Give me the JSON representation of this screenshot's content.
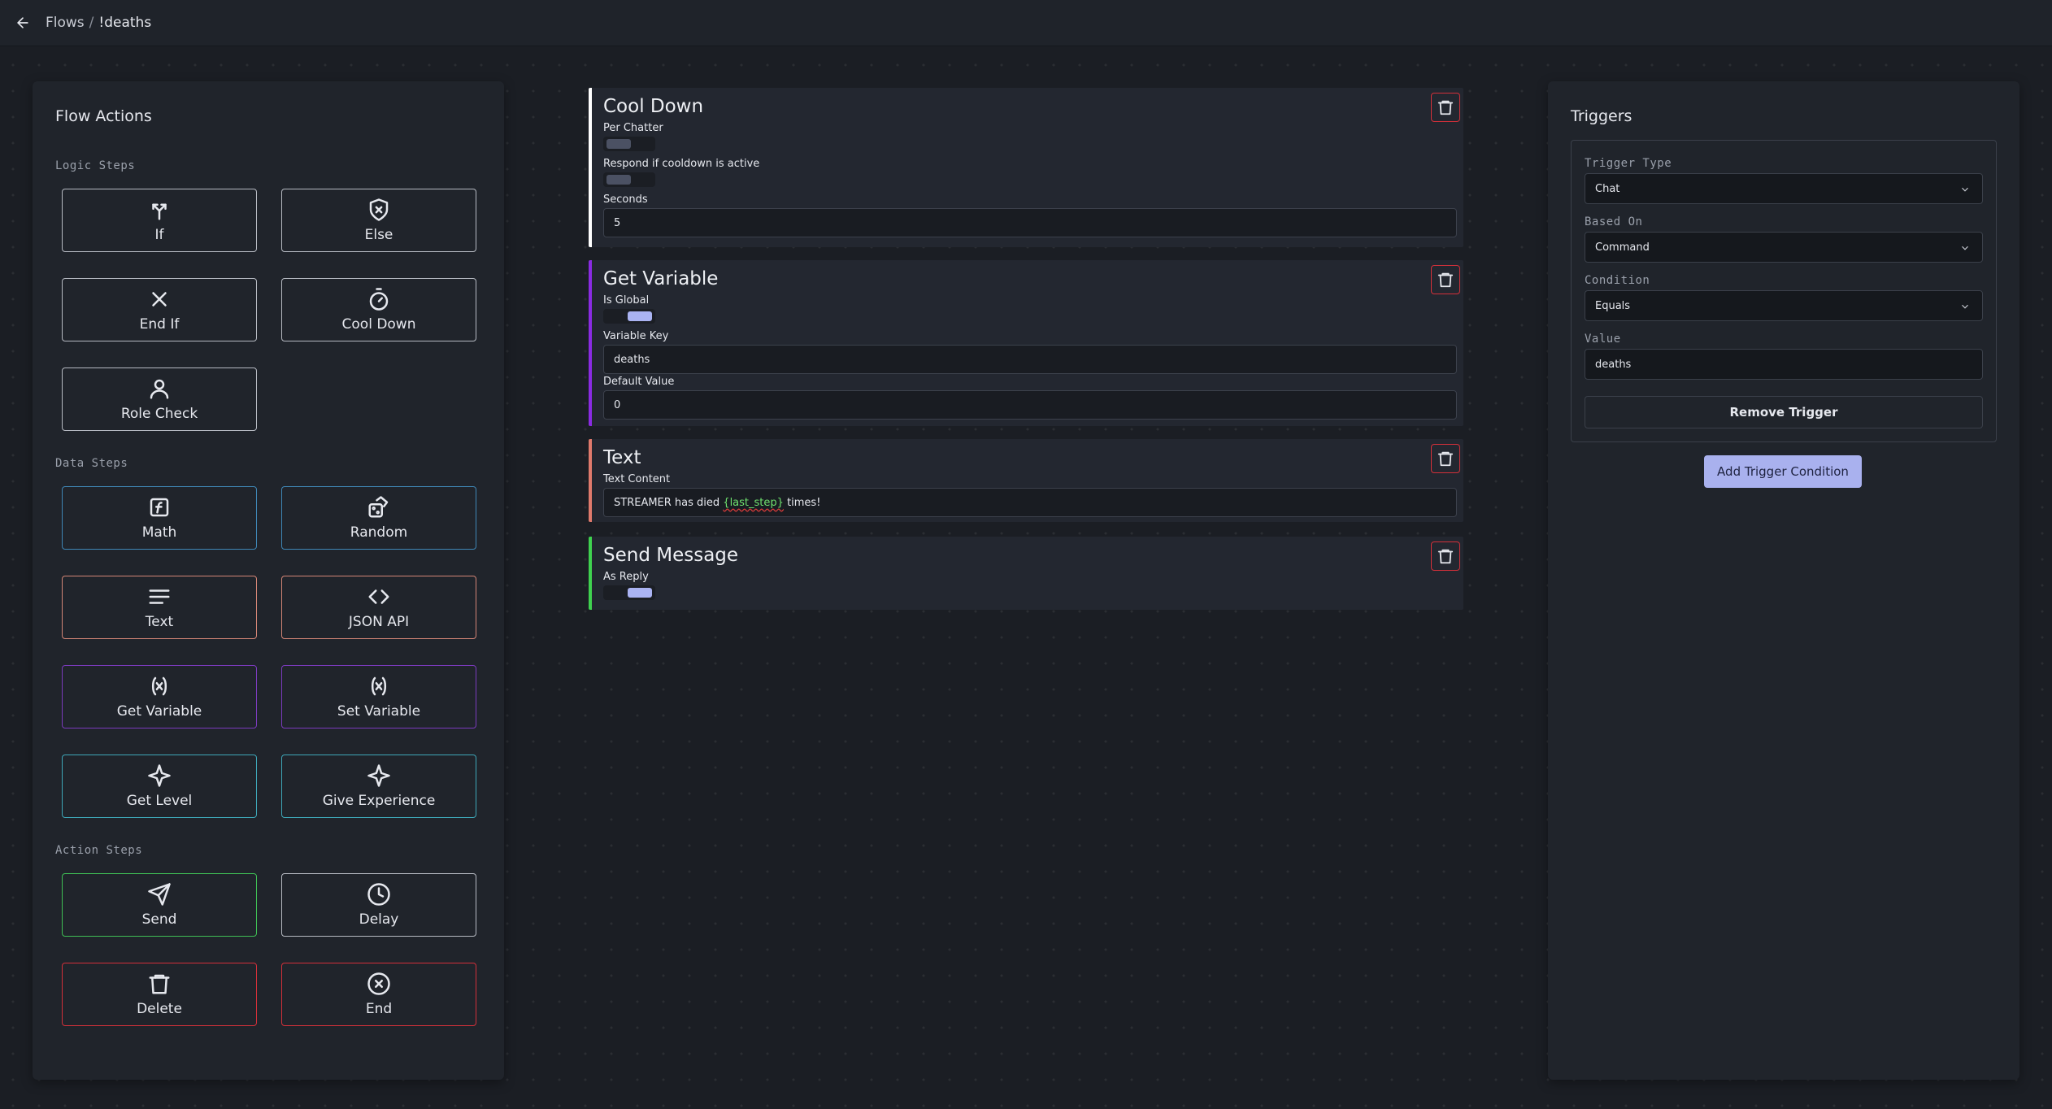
{
  "header": {
    "back_icon": "arrow-left-icon",
    "breadcrumb": {
      "parent": "Flows",
      "separator": "/",
      "current": "!deaths"
    }
  },
  "flow_actions": {
    "title": "Flow Actions",
    "logic_label": "Logic Steps",
    "logic": [
      {
        "label": "If",
        "icon": "branch-icon"
      },
      {
        "label": "Else",
        "icon": "shield-x-icon"
      },
      {
        "label": "End If",
        "icon": "x-icon"
      },
      {
        "label": "Cool Down",
        "icon": "timer-icon"
      },
      {
        "label": "Role Check",
        "icon": "user-icon"
      }
    ],
    "data_label": "Data Steps",
    "data": [
      {
        "label": "Math",
        "icon": "function-icon"
      },
      {
        "label": "Random",
        "icon": "dice-icon"
      },
      {
        "label": "Text",
        "icon": "text-lines-icon"
      },
      {
        "label": "JSON API",
        "icon": "code-icon"
      },
      {
        "label": "Get Variable",
        "icon": "variable-icon"
      },
      {
        "label": "Set Variable",
        "icon": "variable-icon"
      },
      {
        "label": "Get Level",
        "icon": "sparkle-icon"
      },
      {
        "label": "Give Experience",
        "icon": "sparkle-icon"
      }
    ],
    "action_label": "Action Steps",
    "actions": [
      {
        "label": "Send",
        "icon": "send-icon"
      },
      {
        "label": "Delay",
        "icon": "clock-icon"
      },
      {
        "label": "Delete",
        "icon": "trash-icon"
      },
      {
        "label": "End",
        "icon": "x-circle-icon"
      }
    ]
  },
  "steps": {
    "cooldown": {
      "title": "Cool Down",
      "per_chatter_label": "Per Chatter",
      "respond_label": "Respond if cooldown is active",
      "seconds_label": "Seconds",
      "seconds_value": "5",
      "color": "#ffffff"
    },
    "get_variable": {
      "title": "Get Variable",
      "is_global_label": "Is Global",
      "key_label": "Variable Key",
      "key_value": "deaths",
      "default_label": "Default Value",
      "default_value": "0",
      "color": "#8a2be2"
    },
    "text": {
      "title": "Text",
      "content_label": "Text Content",
      "content_before": "STREAMER has died",
      "content_var": "{last_step}",
      "content_after": "times!",
      "color": "#e07a6c"
    },
    "send_message": {
      "title": "Send Message",
      "reply_label": "As Reply",
      "color": "#3fd14f"
    }
  },
  "triggers": {
    "title": "Triggers",
    "trigger_type_label": "Trigger Type",
    "trigger_type_value": "Chat",
    "based_on_label": "Based On",
    "based_on_value": "Command",
    "condition_label": "Condition",
    "condition_value": "Equals",
    "value_label": "Value",
    "value_value": "deaths",
    "remove_label": "Remove Trigger",
    "add_label": "Add Trigger Condition"
  }
}
